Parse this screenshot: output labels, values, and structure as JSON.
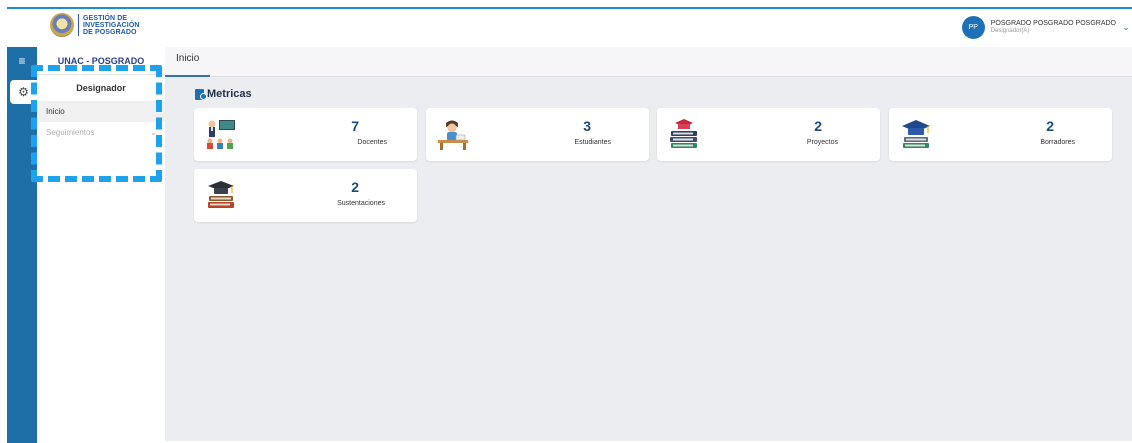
{
  "header": {
    "logo_lines": [
      "GESTIÓN DE",
      "INVESTIGACIÓN",
      "DE POSGRADO"
    ],
    "user_initials": "PP",
    "user_name": "POSGRADO POSGRADO POSGRADO",
    "user_role": "Designador(A)"
  },
  "sidebar": {
    "org": "UNAC - POSGRADO",
    "role_title": "Designador",
    "items": [
      {
        "label": "Inicio"
      },
      {
        "label": "Seguimientos"
      }
    ]
  },
  "tabs": [
    {
      "label": "Inicio"
    }
  ],
  "main": {
    "section_title": "Metricas",
    "cards": [
      {
        "value": "7",
        "label": "Docentes",
        "icon": "teacher-icon"
      },
      {
        "value": "3",
        "label": "Estudiantes",
        "icon": "student-icon"
      },
      {
        "value": "2",
        "label": "Proyectos",
        "icon": "books-cap-icon"
      },
      {
        "value": "2",
        "label": "Borradores",
        "icon": "graduation-cap-icon"
      },
      {
        "value": "2",
        "label": "Sustentaciones",
        "icon": "cap-on-books-icon"
      }
    ]
  },
  "colors": {
    "rail": "#1f6fa7",
    "accent": "#1ea2ec",
    "value": "#1c4c7a"
  }
}
